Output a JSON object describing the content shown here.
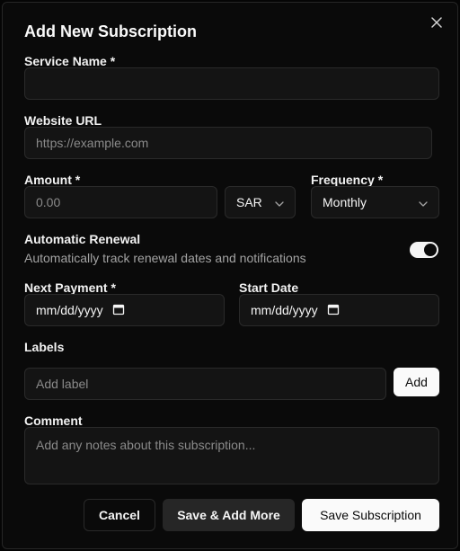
{
  "dialog": {
    "title": "Add New Subscription",
    "close_icon": "close-icon"
  },
  "fields": {
    "service_name": {
      "label": "Service Name *",
      "value": "",
      "placeholder": ""
    },
    "website_url": {
      "label": "Website URL",
      "value": "",
      "placeholder": "https://example.com"
    },
    "amount": {
      "label": "Amount *",
      "value": "",
      "placeholder": "0.00"
    },
    "currency": {
      "value": "SAR"
    },
    "frequency": {
      "label": "Frequency *",
      "value": "Monthly"
    },
    "auto_renewal": {
      "label": "Automatic Renewal",
      "description": "Automatically track renewal dates and notifications",
      "enabled": true
    },
    "next_payment": {
      "label": "Next Payment *",
      "value": "mm/dd/yyyy"
    },
    "start_date": {
      "label": "Start Date",
      "value": "mm/dd/yyyy"
    },
    "labels": {
      "label": "Labels",
      "placeholder": "Add label",
      "add_button": "Add"
    },
    "comment": {
      "label": "Comment",
      "placeholder": "Add any notes about this subscription..."
    }
  },
  "actions": {
    "cancel": "Cancel",
    "save_add_more": "Save & Add More",
    "save": "Save Subscription"
  },
  "colors": {
    "background": "#0a0a0a",
    "border": "#2a2a2a",
    "primary_button": "#fafafa",
    "secondary_button": "#262626"
  }
}
